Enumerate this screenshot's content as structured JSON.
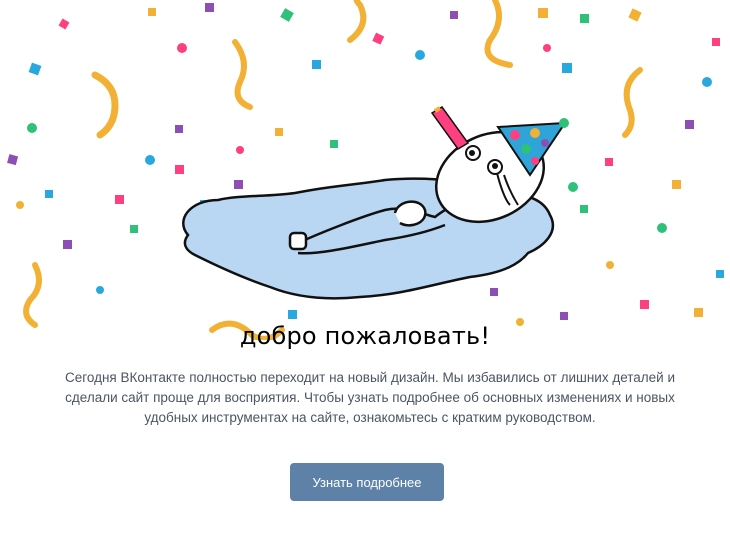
{
  "welcome": {
    "title": "добро пожаловать!",
    "text": "Сегодня ВКонтакте полностью переходит на новый дизайн. Мы избавились от лишних деталей и сделали сайт проще для восприятия. Чтобы узнать подробнее об основных изменениях и новых удобных инструментах на сайте, ознакомьтесь с кратким руководством.",
    "button_label": "Узнать подробнее"
  },
  "colors": {
    "button": "#5e81a8",
    "text": "#4b5563",
    "puddle": "#b9d6f2"
  },
  "illustration": {
    "subject": "meme character lying in a puddle of tears wearing a party hat",
    "decoration": "confetti and streamers"
  }
}
